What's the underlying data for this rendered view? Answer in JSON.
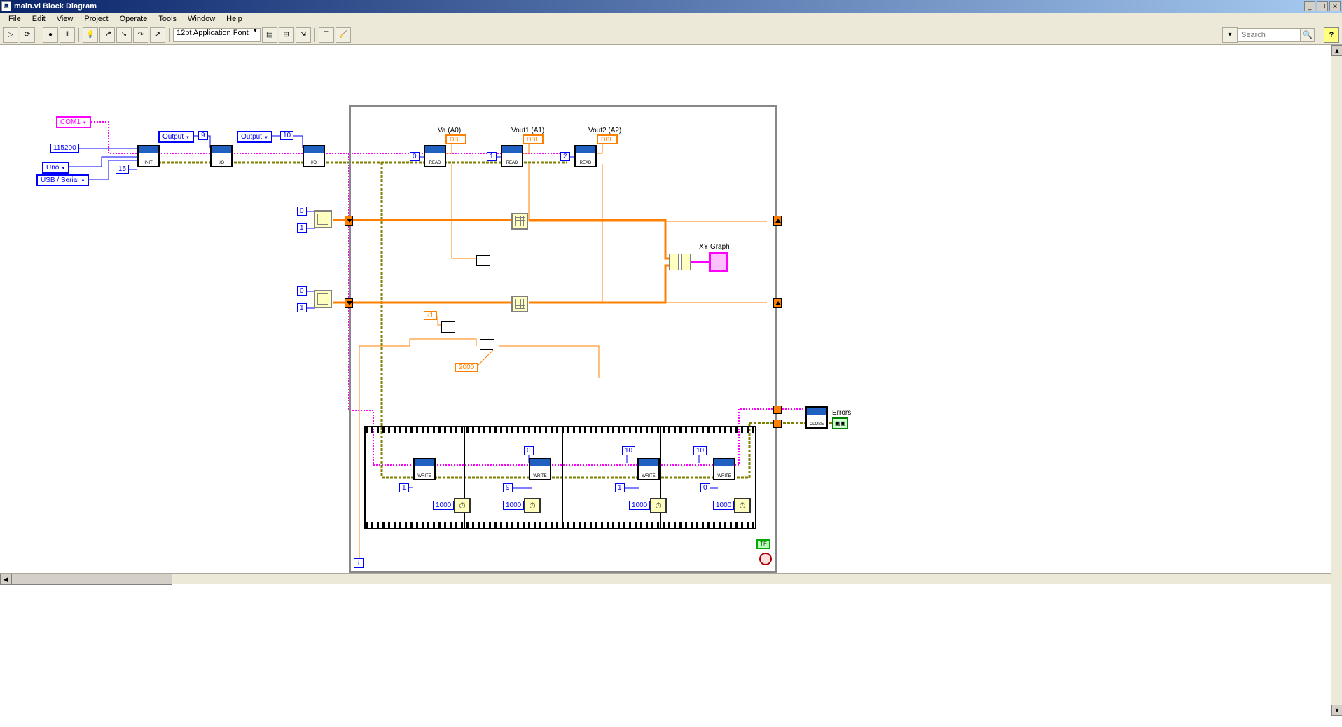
{
  "window": {
    "title": "main.vi Block Diagram"
  },
  "menu": {
    "file": "File",
    "edit": "Edit",
    "view": "View",
    "project": "Project",
    "operate": "Operate",
    "tools": "Tools",
    "window": "Window",
    "help": "Help"
  },
  "toolbar": {
    "font": "12pt Application Font",
    "search_placeholder": "Search"
  },
  "constants": {
    "com_port": "COM1",
    "baud": "115200",
    "board": "Uno",
    "protocol": "USB / Serial",
    "bytes": "15",
    "pin_mode1": "Output",
    "pin_mode2": "Output",
    "pin9": "9",
    "pin10": "10",
    "read_ch0": "0",
    "read_ch1": "1",
    "read_ch2": "2",
    "init0_a": "0",
    "init0_b": "1",
    "init1_a": "0",
    "init1_b": "1",
    "neg1": "-1",
    "div2000": "2000",
    "wait_ms": "1000",
    "seq_pin9a": "9",
    "seq_pin9b": "9",
    "seq_pin10a": "10",
    "seq_pin10b": "10",
    "seq_val0a": "0",
    "seq_val0b": "0",
    "seq_val1a": "1",
    "seq_val1b": "1"
  },
  "labels": {
    "va": "Va (A0)",
    "vout1": "Vout1 (A1)",
    "vout2": "Vout2 (A2)",
    "xygraph": "XY Graph",
    "errors": "Errors",
    "dbl": "DBL",
    "tf": "TF"
  },
  "subvi": {
    "init": "INIT",
    "io": "I/O",
    "read": "READ",
    "write": "WRITE",
    "close": "CLOSE"
  }
}
